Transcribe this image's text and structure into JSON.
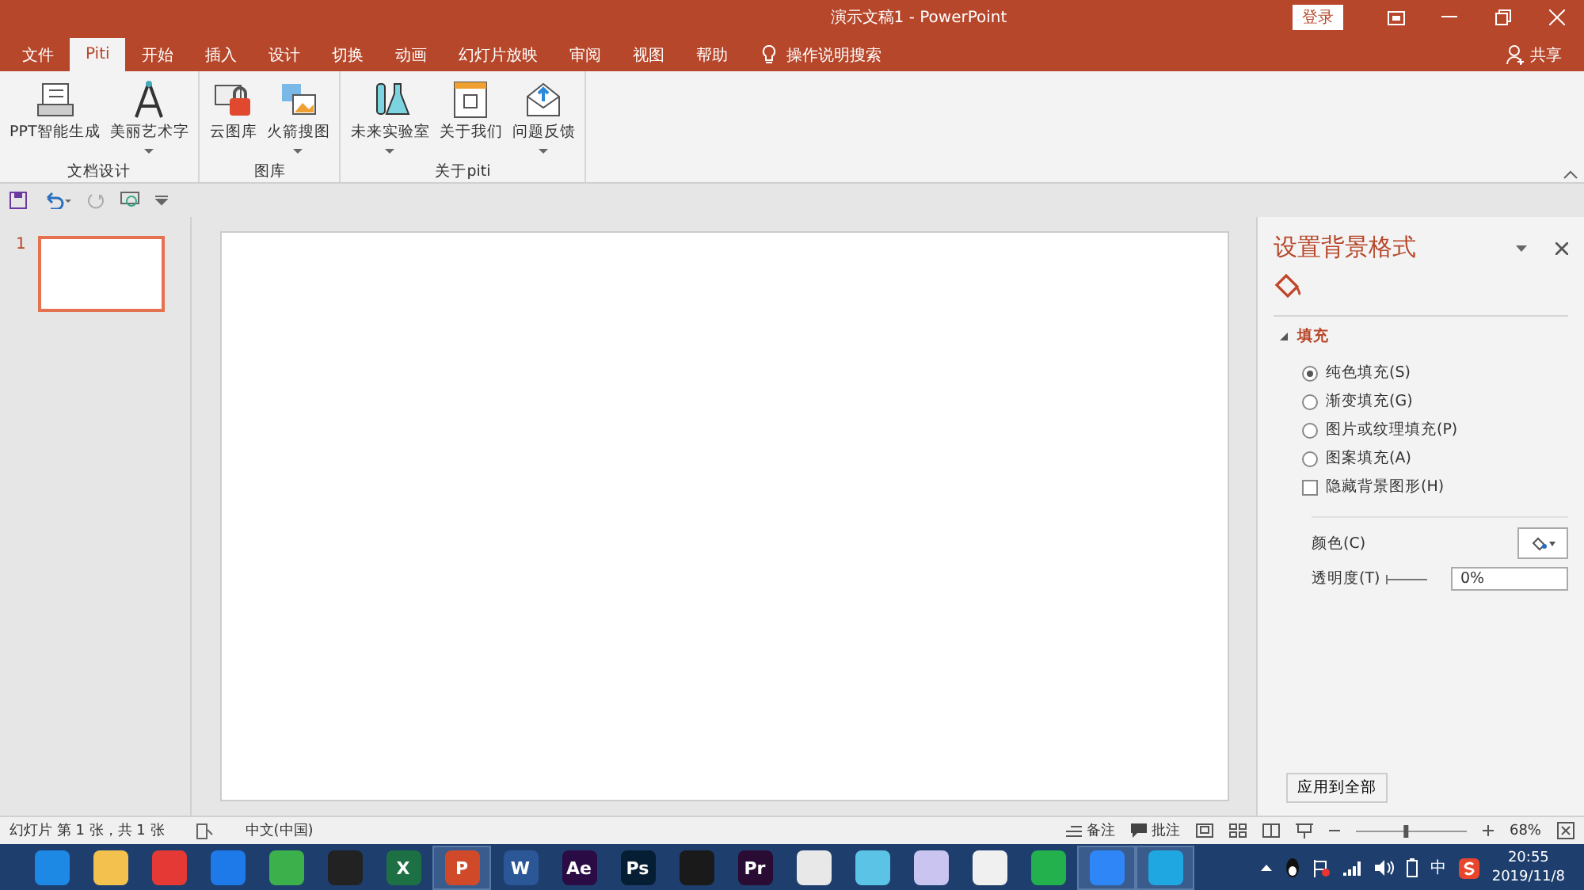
{
  "window": {
    "title": "演示文稿1  -  PowerPoint",
    "login": "登录",
    "share": "共享"
  },
  "tabs": [
    {
      "label": "文件",
      "selected": false
    },
    {
      "label": "Piti",
      "selected": true
    },
    {
      "label": "开始",
      "selected": false
    },
    {
      "label": "插入",
      "selected": false
    },
    {
      "label": "设计",
      "selected": false
    },
    {
      "label": "切换",
      "selected": false
    },
    {
      "label": "动画",
      "selected": false
    },
    {
      "label": "幻灯片放映",
      "selected": false
    },
    {
      "label": "审阅",
      "selected": false
    },
    {
      "label": "视图",
      "selected": false
    },
    {
      "label": "帮助",
      "selected": false
    }
  ],
  "tell_me": "操作说明搜索",
  "ribbon_groups": [
    {
      "label": "文档设计",
      "buttons": [
        {
          "label": "PPT智能生成",
          "kind": "printer",
          "dropdown": false
        },
        {
          "label": "美丽艺术字",
          "kind": "compass",
          "dropdown": true
        }
      ]
    },
    {
      "label": "图库",
      "buttons": [
        {
          "label": "云图库",
          "kind": "lock",
          "dropdown": false
        },
        {
          "label": "火箭搜图",
          "kind": "images",
          "dropdown": true
        }
      ]
    },
    {
      "label": "关于piti",
      "buttons": [
        {
          "label": "未来实验室",
          "kind": "flask",
          "dropdown": true
        },
        {
          "label": "关于我们",
          "kind": "frame",
          "dropdown": false
        },
        {
          "label": "问题反馈",
          "kind": "mail",
          "dropdown": true
        }
      ]
    }
  ],
  "slides": [
    {
      "number": "1",
      "selected": true
    }
  ],
  "pane": {
    "title": "设置背景格式",
    "section": "填充",
    "options": [
      {
        "kind": "radio",
        "label": "纯色填充(S)",
        "selected": true
      },
      {
        "kind": "radio",
        "label": "渐变填充(G)",
        "selected": false
      },
      {
        "kind": "radio",
        "label": "图片或纹理填充(P)",
        "selected": false
      },
      {
        "kind": "radio",
        "label": "图案填充(A)",
        "selected": false
      },
      {
        "kind": "checkbox",
        "label": "隐藏背景图形(H)",
        "checked": false
      }
    ],
    "color_label": "颜色(C)",
    "transparency_label": "透明度(T)",
    "transparency_value": "0%",
    "apply_all": "应用到全部"
  },
  "status_bar": {
    "slide_info": "幻灯片 第 1 张，共 1 张",
    "language": "中文(中国)",
    "notes": "备注",
    "comments": "批注",
    "zoom": "68%",
    "zoom_slider": {
      "level": 0.45
    }
  },
  "taskbar": {
    "apps": [
      {
        "color": "#1e88e5",
        "active": false
      },
      {
        "color": "#f2c14e",
        "active": false
      },
      {
        "color": "#e53935",
        "active": false
      },
      {
        "color": "#1e7ae8",
        "active": false
      },
      {
        "color": "#3cb04a",
        "active": false
      },
      {
        "color": "#222222",
        "active": false
      },
      {
        "label": "X",
        "color": "#1d7044",
        "active": false
      },
      {
        "label": "P",
        "color": "#d04a2a",
        "active": true
      },
      {
        "label": "W",
        "color": "#2b5797",
        "active": false
      },
      {
        "label": "Ae",
        "color": "#2a0b44",
        "active": false
      },
      {
        "label": "Ps",
        "color": "#061e33",
        "active": false
      },
      {
        "color": "#1a1a1a",
        "active": false
      },
      {
        "label": "Pr",
        "color": "#2a0b33",
        "active": false
      },
      {
        "color": "#e8e8e8",
        "active": false
      },
      {
        "color": "#5ac3e6",
        "active": false
      },
      {
        "color": "#c9c4f0",
        "active": false
      },
      {
        "color": "#f0f0f0",
        "active": false
      },
      {
        "color": "#22b14c",
        "active": false
      },
      {
        "color": "#2f86f6",
        "active": true
      },
      {
        "color": "#1ea7e1",
        "active": true
      }
    ],
    "ime": "中",
    "time": "20:55",
    "date": "2019/11/8"
  }
}
